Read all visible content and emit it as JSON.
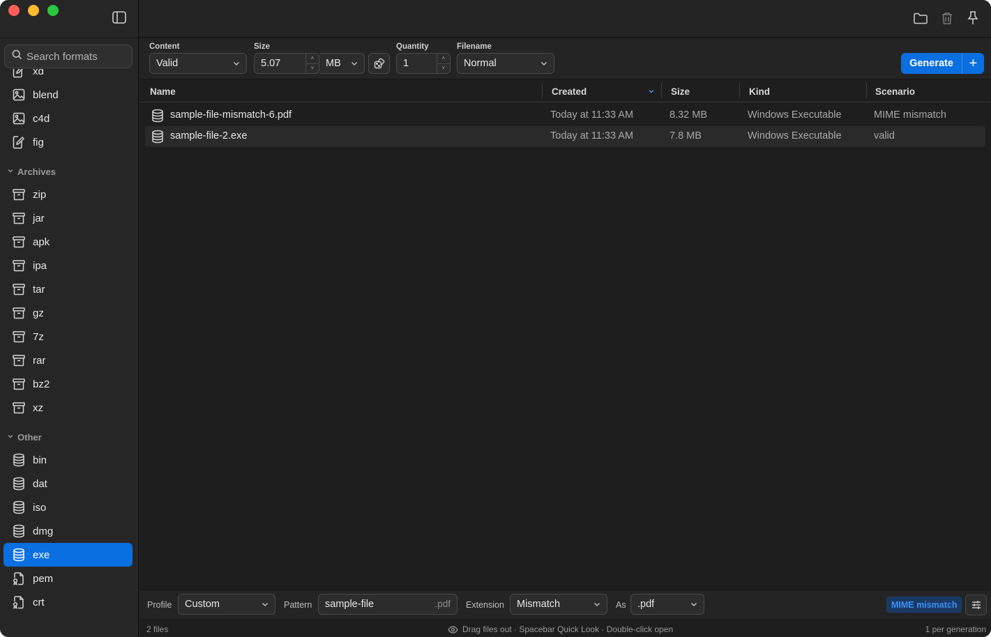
{
  "sidebar": {
    "search_placeholder": "Search formats",
    "top_items": [
      {
        "label": "xd",
        "icon": "pen-document-icon"
      },
      {
        "label": "blend",
        "icon": "image-icon"
      },
      {
        "label": "c4d",
        "icon": "image-icon"
      },
      {
        "label": "fig",
        "icon": "pen-document-icon"
      }
    ],
    "groups": [
      {
        "name": "Archives",
        "items": [
          {
            "label": "zip",
            "icon": "archive-box-icon"
          },
          {
            "label": "jar",
            "icon": "archive-box-icon"
          },
          {
            "label": "apk",
            "icon": "archive-box-icon"
          },
          {
            "label": "ipa",
            "icon": "archive-box-icon"
          },
          {
            "label": "tar",
            "icon": "archive-box-icon"
          },
          {
            "label": "gz",
            "icon": "archive-box-icon"
          },
          {
            "label": "7z",
            "icon": "archive-box-icon"
          },
          {
            "label": "rar",
            "icon": "archive-box-icon"
          },
          {
            "label": "bz2",
            "icon": "archive-box-icon"
          },
          {
            "label": "xz",
            "icon": "archive-box-icon"
          }
        ]
      },
      {
        "name": "Other",
        "items": [
          {
            "label": "bin",
            "icon": "database-icon"
          },
          {
            "label": "dat",
            "icon": "database-icon"
          },
          {
            "label": "iso",
            "icon": "database-icon"
          },
          {
            "label": "dmg",
            "icon": "database-icon"
          },
          {
            "label": "exe",
            "icon": "database-icon",
            "active": true
          },
          {
            "label": "pem",
            "icon": "certificate-file-icon"
          },
          {
            "label": "crt",
            "icon": "certificate-file-icon"
          }
        ]
      }
    ]
  },
  "toolbar": {
    "content_label": "Content",
    "content_value": "Valid",
    "size_label": "Size",
    "size_value": "5.07",
    "size_unit": "MB",
    "quantity_label": "Quantity",
    "quantity_value": "1",
    "filename_label": "Filename",
    "filename_value": "Normal",
    "generate_label": "Generate",
    "generate_plus": "+"
  },
  "table": {
    "columns": [
      "Name",
      "Created",
      "Size",
      "Kind",
      "Scenario"
    ],
    "rows": [
      {
        "name": "sample-file-mismatch-6.pdf",
        "created": "Today at 11:33 AM",
        "size": "8.32 MB",
        "kind": "Windows Executable",
        "scenario": "MIME mismatch"
      },
      {
        "name": "sample-file-2.exe",
        "created": "Today at 11:33 AM",
        "size": "7.8 MB",
        "kind": "Windows Executable",
        "scenario": "valid"
      }
    ]
  },
  "bottombar": {
    "profile_label": "Profile",
    "profile_value": "Custom",
    "pattern_label": "Pattern",
    "pattern_value": "sample-file",
    "pattern_suffix": ".pdf",
    "extension_label": "Extension",
    "extension_value": "Mismatch",
    "as_label": "As",
    "as_value": ".pdf",
    "badge": "MIME mismatch"
  },
  "status": {
    "file_count": "2 files",
    "hint": "Drag files out · Spacebar Quick Look · Double-click open",
    "per_generation": "1 per generation"
  },
  "colors": {
    "accent": "#0a6fe0",
    "window_bg": "#1e1e1e",
    "sidebar_bg": "#262626"
  }
}
